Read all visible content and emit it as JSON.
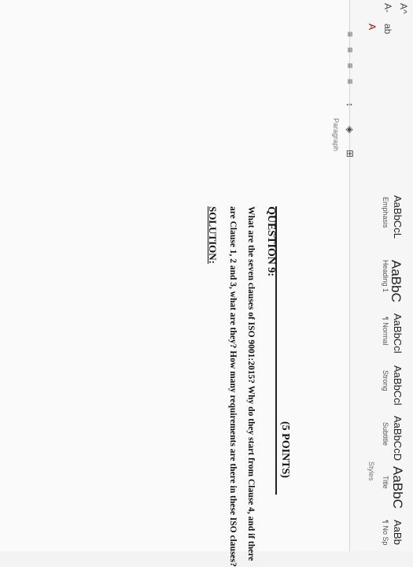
{
  "ribbon": {
    "styles": [
      {
        "preview": "AaBbCcL",
        "name": "Emphasis"
      },
      {
        "preview": "AaBbC",
        "name": "Heading 1"
      },
      {
        "preview": "AaBbCcl",
        "name": "¶ Normal"
      },
      {
        "preview": "AaBbCcl",
        "name": "Strong"
      },
      {
        "preview": "AaBbCcD",
        "name": "Subtitle"
      },
      {
        "preview": "AaBbC",
        "name": "Title"
      },
      {
        "preview": "AaBb",
        "name": "¶ No Sp"
      }
    ],
    "styles_group_label": "Styles",
    "paragraph_group_label": "Paragraph",
    "font_tools": [
      "A^",
      "A-",
      "A",
      "ab"
    ],
    "para_tools": [
      "≡",
      "≡",
      "≡",
      "≡",
      "↕",
      "◈",
      "⊞"
    ]
  },
  "document": {
    "question_title": "QUESTION 9:",
    "points": "(5 POINTS)",
    "body_line1": "What are the seven clauses of ISO 9001:2015? Why do they start from Clause 4, and if there",
    "body_line2": "are Clause 1, 2 and 3, what are they? How many requirements are there in these ISO clauses?",
    "solution_label": "SOLUTION:"
  }
}
